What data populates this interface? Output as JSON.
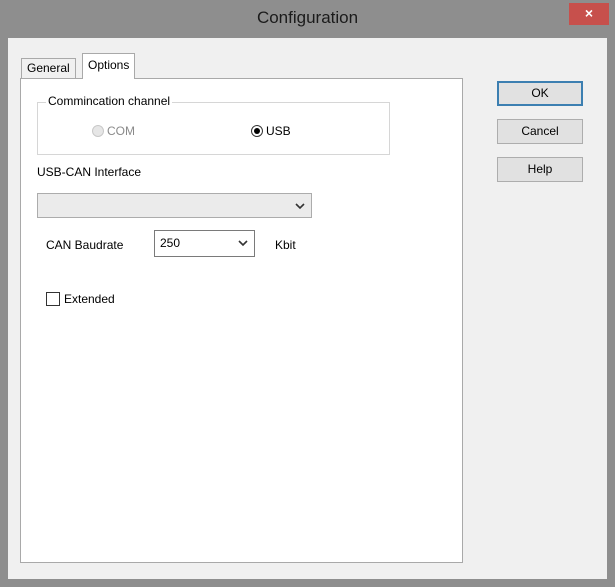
{
  "window": {
    "title": "Configuration",
    "close_label": "×"
  },
  "tabs": [
    {
      "label": "General"
    },
    {
      "label": "Options"
    }
  ],
  "options": {
    "group_label": "Commincation channel",
    "com_label": "COM",
    "usb_label": "USB",
    "selected_channel": "USB",
    "com_enabled": false,
    "interface_label": "USB-CAN Interface",
    "interface_value": "",
    "baud_label": "CAN Baudrate",
    "baud_value": "250",
    "baud_unit": "Kbit",
    "extended_label": "Extended",
    "extended_checked": false
  },
  "buttons": {
    "ok": "OK",
    "cancel": "Cancel",
    "help": "Help"
  },
  "colors": {
    "close": "#c7504c",
    "frame": "#8e8e8e",
    "default_button_border": "#3c7fb1"
  },
  "icons": {
    "close": "close-icon",
    "dropdown": "chevron-down-icon"
  }
}
